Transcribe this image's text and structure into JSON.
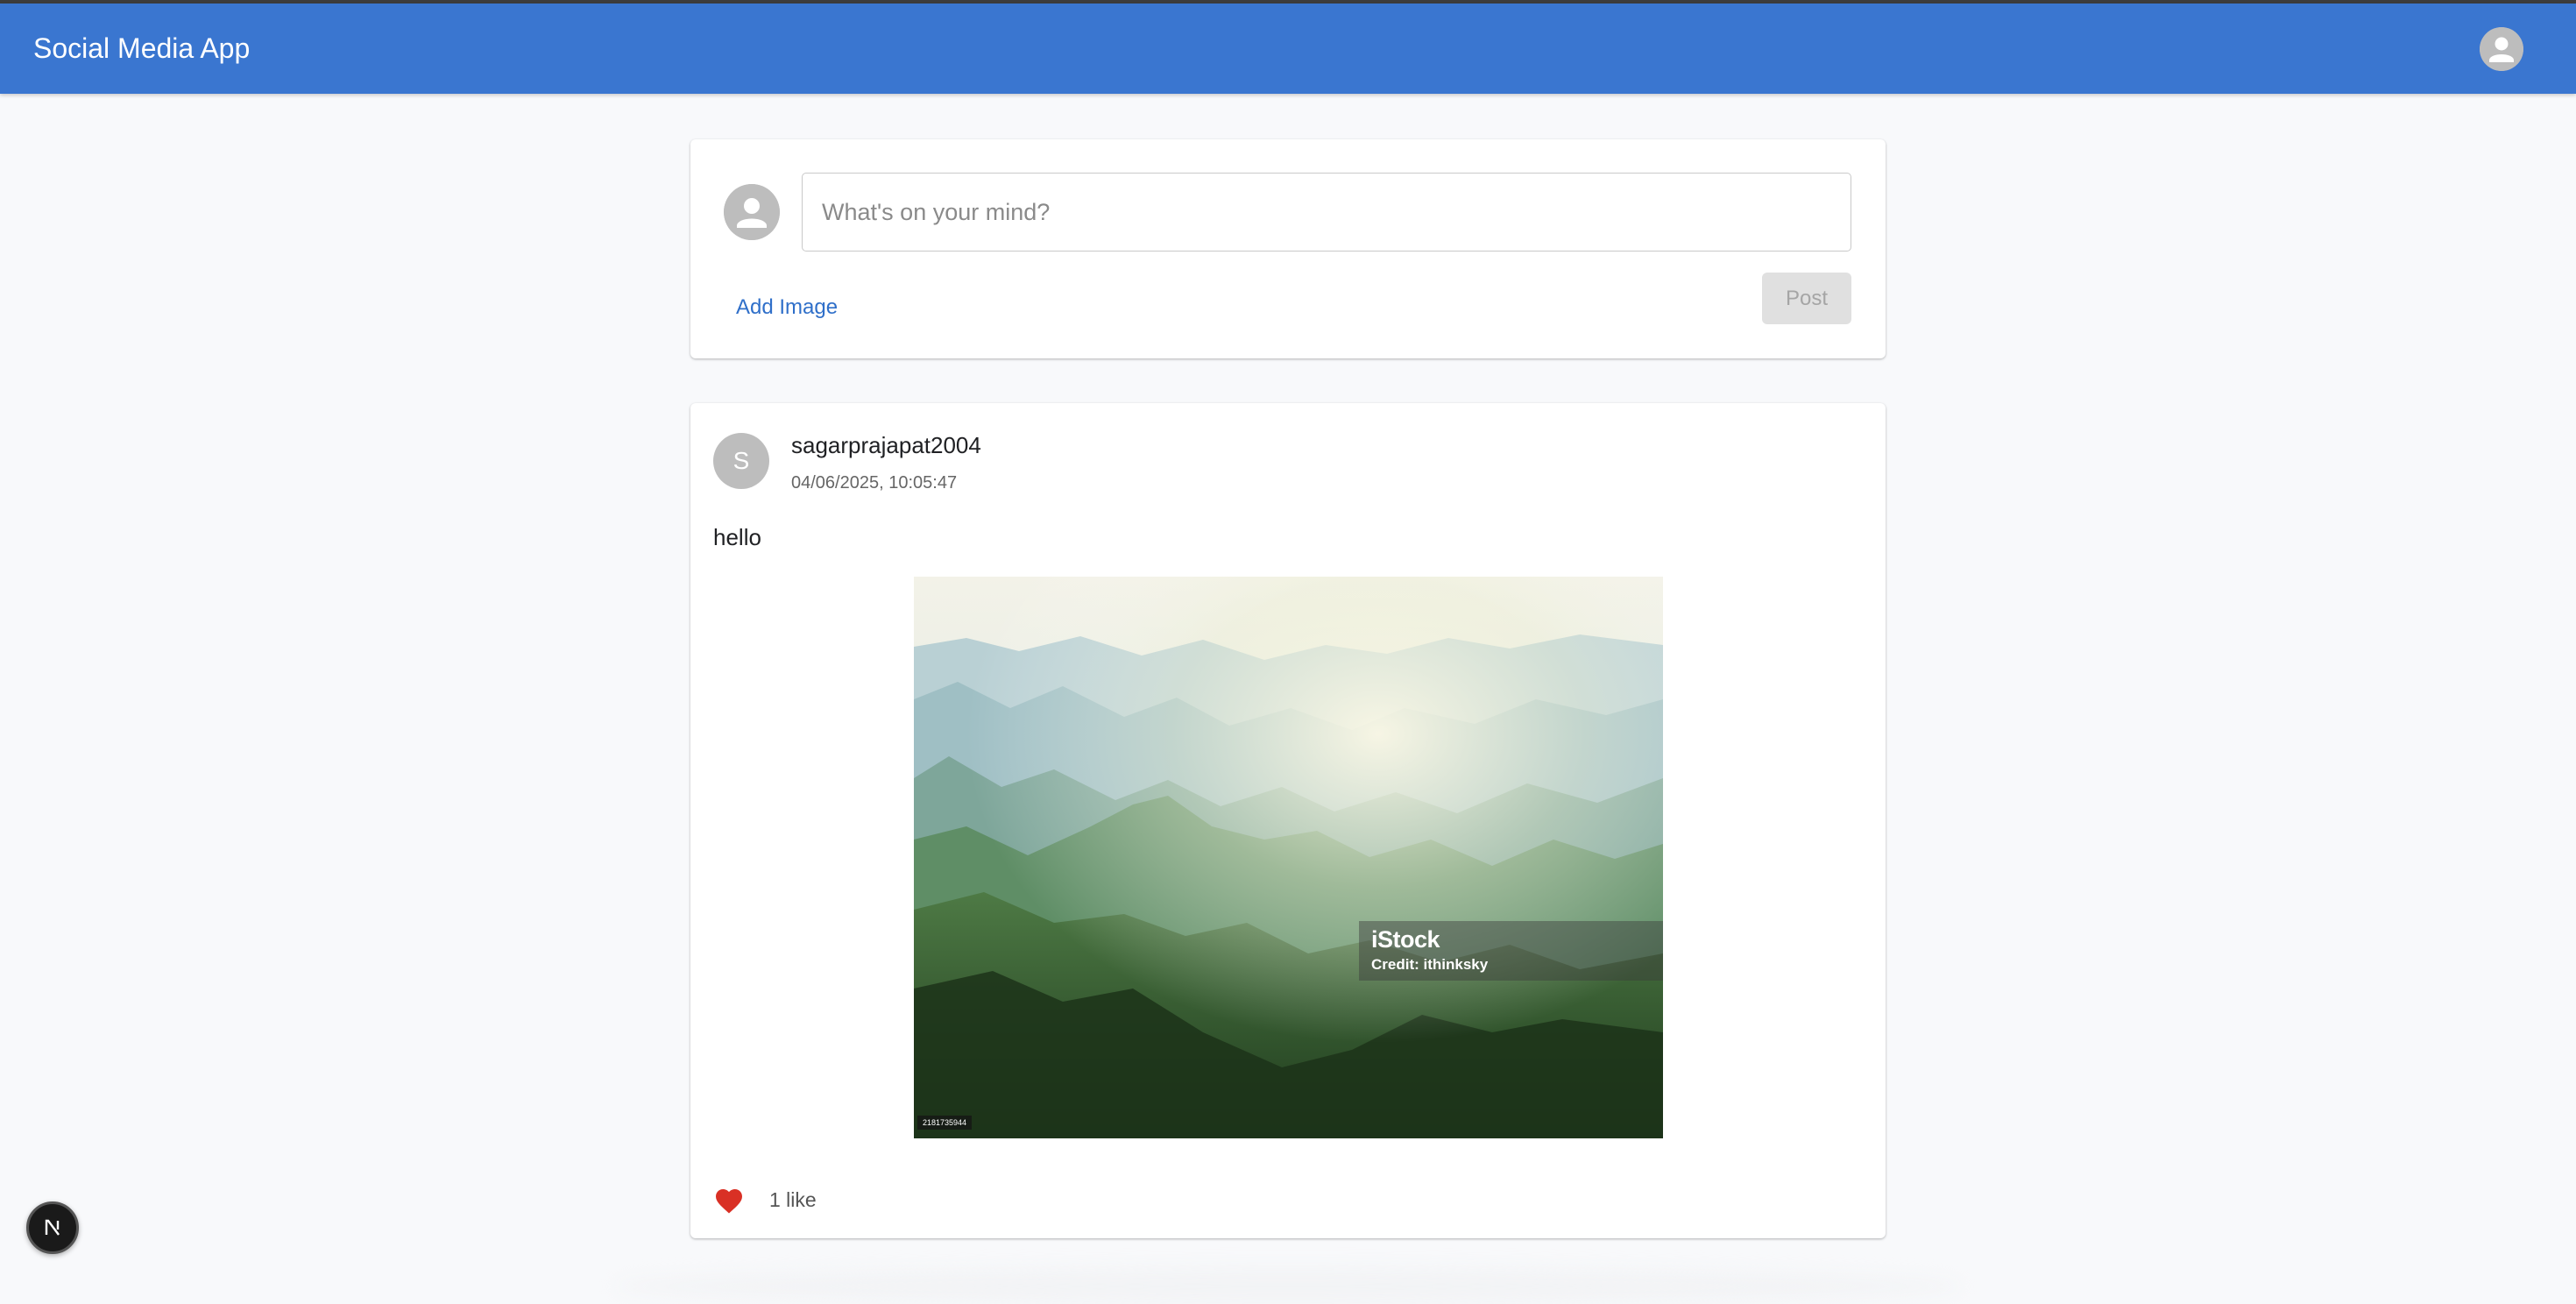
{
  "app": {
    "title": "Social Media App"
  },
  "composer": {
    "placeholder": "What's on your mind?",
    "add_image_label": "Add Image",
    "post_label": "Post"
  },
  "post": {
    "avatar_letter": "S",
    "author": "sagarprajapat2004",
    "timestamp": "04/06/2025, 10:05:47",
    "text": "hello",
    "image": {
      "subject": "misty green mountain ranges at sunrise",
      "watermark_brand": "iStock",
      "watermark_credit": "Credit: ithinksky",
      "image_id": "2181735944"
    },
    "likes_label": "1 like",
    "liked": true
  },
  "colors": {
    "appbar": "#3a76d0",
    "link": "#2f6fc9",
    "like_heart": "#d93025"
  },
  "icons": {
    "appbar_avatar": "account-circle-icon",
    "composer_avatar": "account-circle-icon",
    "like": "heart-icon",
    "dev_badge": "nextjs-logo-icon"
  }
}
